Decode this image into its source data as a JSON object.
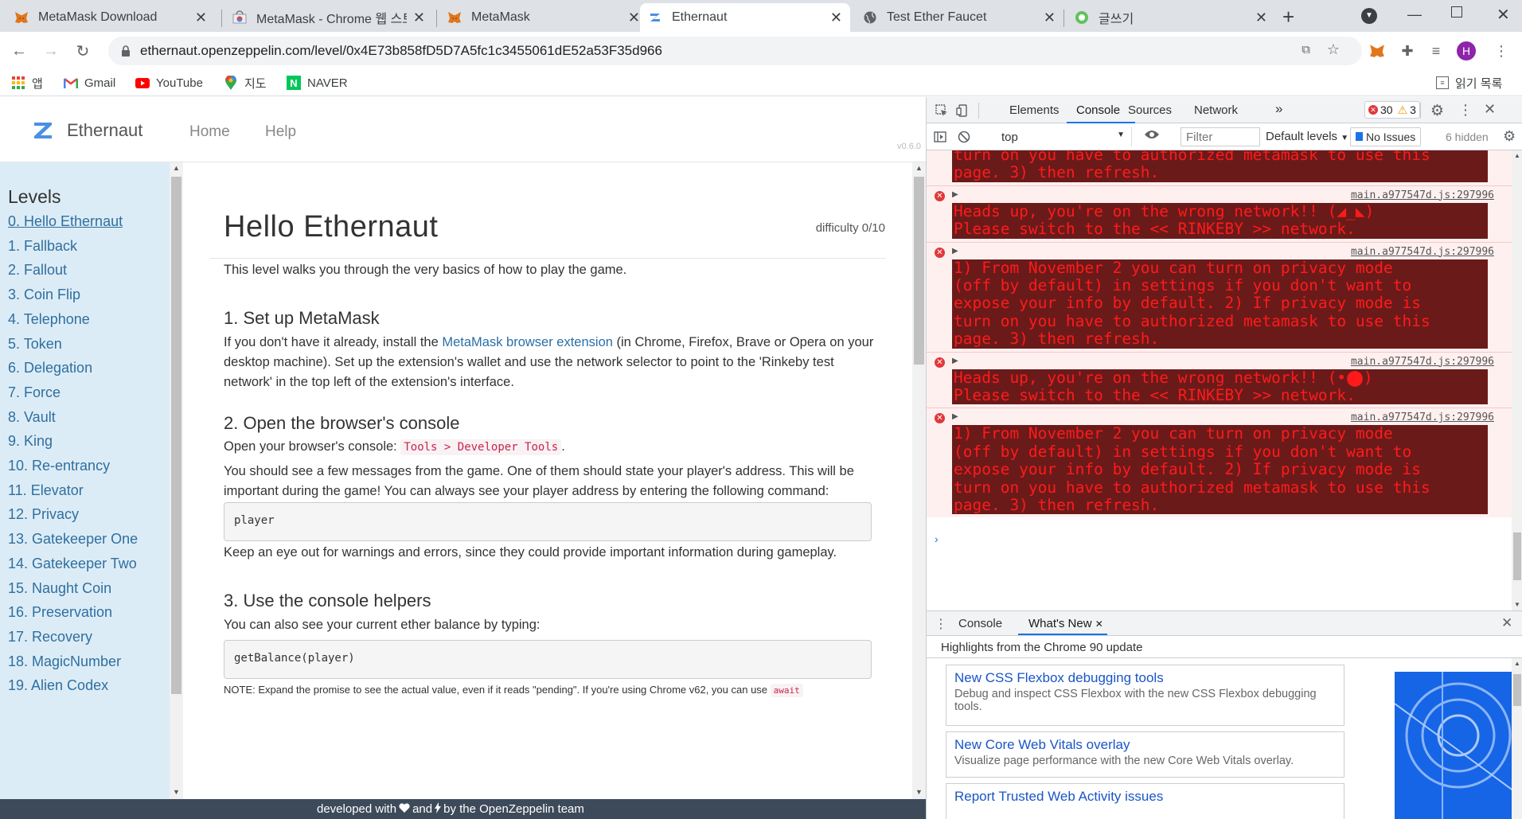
{
  "browser": {
    "tabs": [
      {
        "title": "MetaMask Download",
        "icon": "metamask-fox-icon"
      },
      {
        "title": "MetaMask - Chrome 웹 스토어",
        "icon": "chrome-webstore-icon"
      },
      {
        "title": "MetaMask",
        "icon": "metamask-fox-icon"
      },
      {
        "title": "Ethernaut",
        "icon": "ethernaut-z-icon",
        "active": true
      },
      {
        "title": "Test Ether Faucet",
        "icon": "globe-icon"
      },
      {
        "title": "글쓰기",
        "icon": "naver-blog-icon"
      }
    ],
    "url": "ethernaut.openzeppelin.com/level/0x4E73b858fD5D7A5fc1c3455061dE52a53F35d966",
    "profile_initial": "H",
    "bookmarks": [
      {
        "label": "앱",
        "icon": "apps-grid-icon"
      },
      {
        "label": "Gmail",
        "icon": "gmail-icon"
      },
      {
        "label": "YouTube",
        "icon": "youtube-icon"
      },
      {
        "label": "지도",
        "icon": "maps-pin-icon"
      },
      {
        "label": "NAVER",
        "icon": "naver-icon"
      }
    ],
    "reading_list": "읽기 목록"
  },
  "site": {
    "brand": "Ethernaut",
    "nav": {
      "home": "Home",
      "help": "Help"
    },
    "version": "v0.6.0",
    "levels_title": "Levels",
    "levels": [
      "0. Hello Ethernaut",
      "1. Fallback",
      "2. Fallout",
      "3. Coin Flip",
      "4. Telephone",
      "5. Token",
      "6. Delegation",
      "7. Force",
      "8. Vault",
      "9. King",
      "10. Re-entrancy",
      "11. Elevator",
      "12. Privacy",
      "13. Gatekeeper One",
      "14. Gatekeeper Two",
      "15. Naught Coin",
      "16. Preservation",
      "17. Recovery",
      "18. MagicNumber",
      "19. Alien Codex"
    ],
    "level_title": "Hello Ethernaut",
    "difficulty": "difficulty 0/10",
    "intro": "This level walks you through the very basics of how to play the game.",
    "s1_heading": "1. Set up MetaMask",
    "s1_pre": "If you don't have it already, install the ",
    "s1_link": "MetaMask browser extension",
    "s1_post": " (in Chrome, Firefox, Brave or Opera on your desktop machine). Set up the extension's wallet and use the network selector to point to the 'Rinkeby test network' in the top left of the extension's interface.",
    "s2_heading": "2. Open the browser's console",
    "s2_pre": "Open your browser's console: ",
    "s2_code": "Tools > Developer Tools",
    "s2_post": ".",
    "s2_p2": "You should see a few messages from the game. One of them should state your player's address. This will be important during the game! You can always see your player address by entering the following command:",
    "s2_codebox": "player",
    "s2_p3": "Keep an eye out for warnings and errors, since they could provide important information during gameplay.",
    "s3_heading": "3. Use the console helpers",
    "s3_p1": "You can also see your current ether balance by typing:",
    "s3_codebox": "getBalance(player)",
    "note_pre": "NOTE: Expand the promise to see the actual value, even if it reads \"pending\". If you're using Chrome v62, you can use ",
    "note_code": "await",
    "footer_pre": "developed with ",
    "footer_mid": " and ",
    "footer_post": " by the OpenZeppelin team"
  },
  "devtools": {
    "tabs": [
      "Elements",
      "Console",
      "Sources",
      "Network"
    ],
    "active_tab": "Console",
    "errors": "30",
    "warnings": "3",
    "context": "top",
    "filter_placeholder": "Filter",
    "levels": "Default levels",
    "issues": "No Issues",
    "hidden": "6 hidden",
    "messages": [
      {
        "source": "",
        "lines": [
          "turn on you have to authorized metamask to use this",
          "page. 3) then refresh."
        ]
      },
      {
        "source": "main.a977547d.js:297996",
        "lines": [
          "Heads up, you're on the wrong network!! (◢_◣)",
          "Please switch to the << RINKEBY >> network."
        ]
      },
      {
        "source": "main.a977547d.js:297996",
        "lines": [
          "1) From November 2 you can turn on privacy mode",
          "(off by default) in settings if you don't want to",
          "expose your info by default. 2) If privacy mode is",
          "turn on you have to authorized metamask to use this",
          "page. 3) then refresh."
        ]
      },
      {
        "source": "main.a977547d.js:297996",
        "lines": [
          "Heads up, you're on the wrong network!! (•⬤)",
          "Please switch to the << RINKEBY >> network."
        ]
      },
      {
        "source": "main.a977547d.js:297996",
        "lines": [
          "1) From November 2 you can turn on privacy mode",
          "(off by default) in settings if you don't want to",
          "expose your info by default. 2) If privacy mode is",
          "turn on you have to authorized metamask to use this",
          "page. 3) then refresh."
        ]
      }
    ],
    "drawer_tabs": [
      "Console",
      "What's New"
    ],
    "drawer_subtitle": "Highlights from the Chrome 90 update",
    "whats_new": [
      {
        "title": "New CSS Flexbox debugging tools",
        "desc": "Debug and inspect CSS Flexbox with the new CSS Flexbox debugging tools."
      },
      {
        "title": "New Core Web Vitals overlay",
        "desc": "Visualize page performance with the new Core Web Vitals overlay."
      },
      {
        "title": "Report Trusted Web Activity issues",
        "desc": ""
      }
    ]
  }
}
